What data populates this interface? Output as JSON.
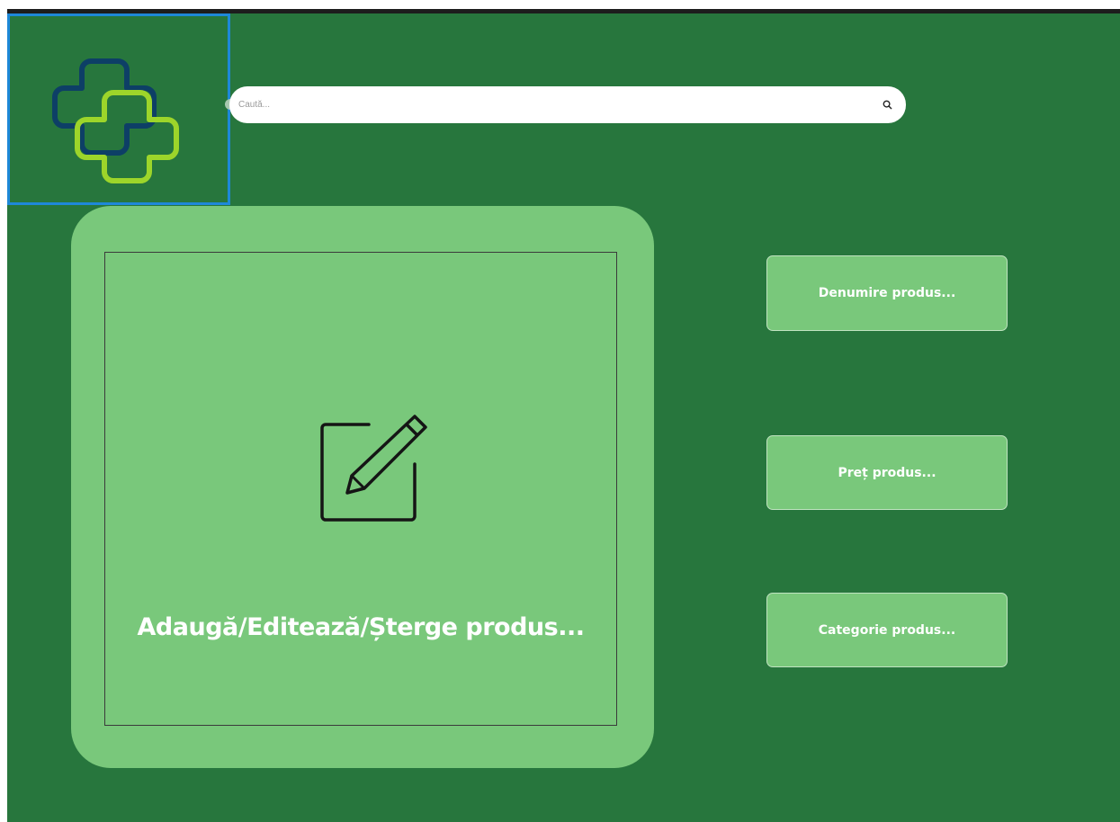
{
  "header": {
    "logo_icon": "medical-cross-logo",
    "colors": {
      "navy": "#0d3f66",
      "lime": "#9dd52a",
      "background": "#27763d",
      "panel": "#79c87b",
      "selection": "#1e88d8"
    }
  },
  "search": {
    "placeholder": "Caută...",
    "icon": "search-icon"
  },
  "main_panel": {
    "icon": "edit-icon",
    "label": "Adaugă/Editează/Șterge produs..."
  },
  "side_buttons": {
    "name_label": "Denumire produs...",
    "price_label": "Preț produs...",
    "category_label": "Categorie produs..."
  }
}
